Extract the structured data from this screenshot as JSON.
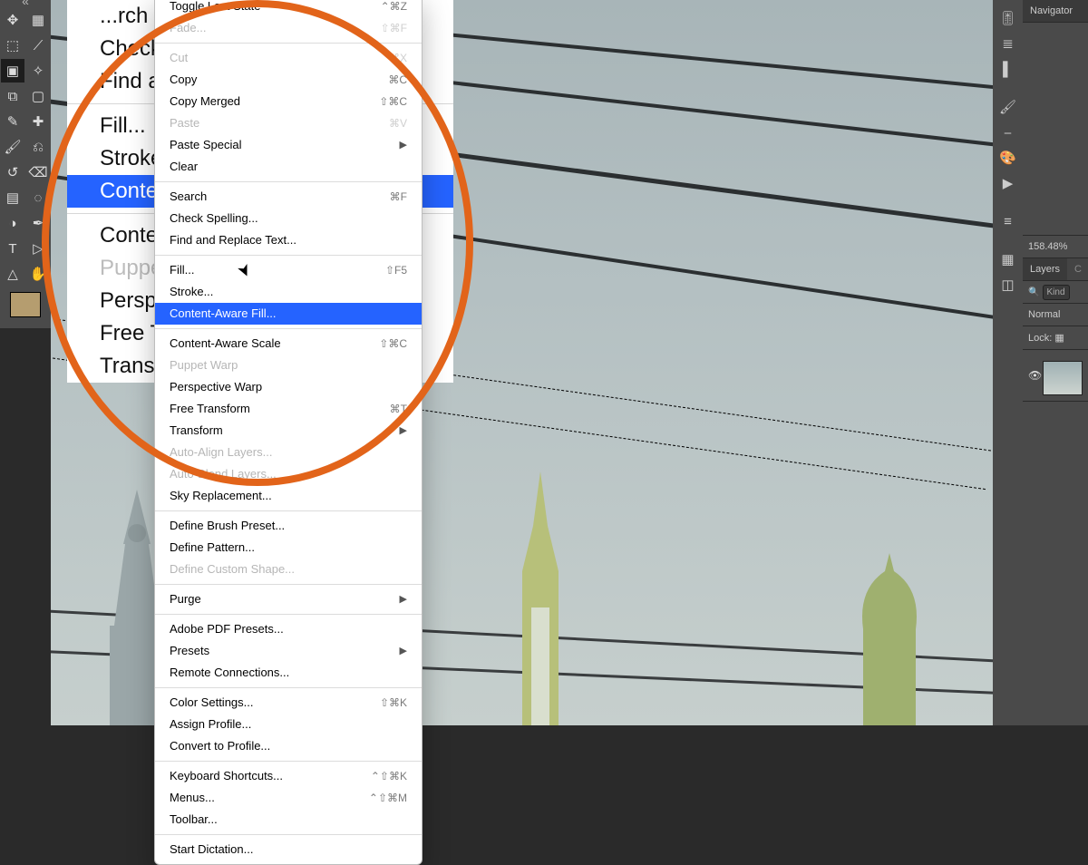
{
  "accent": "#2563ff",
  "highlight_ring": "#e2641a",
  "menu": {
    "top_items": [
      {
        "label": "Toggle Last State",
        "shortcut": "⌃⌘Z",
        "disabled": false
      },
      {
        "label": "Fade...",
        "shortcut": "⇧⌘F",
        "disabled": true
      }
    ],
    "g1": [
      {
        "label": "Cut",
        "shortcut": "⌘X",
        "disabled": true
      },
      {
        "label": "Copy",
        "shortcut": "⌘C",
        "disabled": false
      },
      {
        "label": "Copy Merged",
        "shortcut": "⇧⌘C",
        "disabled": false
      },
      {
        "label": "Paste",
        "shortcut": "⌘V",
        "disabled": true
      },
      {
        "label": "Paste Special",
        "submenu": true,
        "disabled": false
      },
      {
        "label": "Clear",
        "disabled": false
      }
    ],
    "g2": [
      {
        "label": "Search",
        "shortcut": "⌘F"
      },
      {
        "label": "Check Spelling..."
      },
      {
        "label": "Find and Replace Text..."
      }
    ],
    "g3": [
      {
        "label": "Fill...",
        "shortcut": "⇧F5"
      },
      {
        "label": "Stroke..."
      },
      {
        "label": "Content-Aware Fill...",
        "highlight": true
      }
    ],
    "g4": [
      {
        "label": "Content-Aware Scale",
        "shortcut": "⇧⌘C"
      },
      {
        "label": "Puppet Warp",
        "disabled": true
      },
      {
        "label": "Perspective Warp"
      },
      {
        "label": "Free Transform",
        "shortcut": "⌘T"
      },
      {
        "label": "Transform",
        "submenu": true
      },
      {
        "label": "Auto-Align Layers...",
        "disabled": true
      },
      {
        "label": "Auto-Blend Layers...",
        "disabled": true
      },
      {
        "label": "Sky Replacement..."
      }
    ],
    "g5": [
      {
        "label": "Define Brush Preset..."
      },
      {
        "label": "Define Pattern..."
      },
      {
        "label": "Define Custom Shape...",
        "disabled": true
      }
    ],
    "g6": [
      {
        "label": "Purge",
        "submenu": true
      }
    ],
    "g7": [
      {
        "label": "Adobe PDF Presets..."
      },
      {
        "label": "Presets",
        "submenu": true
      },
      {
        "label": "Remote Connections..."
      }
    ],
    "g8": [
      {
        "label": "Color Settings...",
        "shortcut": "⇧⌘K"
      },
      {
        "label": "Assign Profile..."
      },
      {
        "label": "Convert to Profile..."
      }
    ],
    "g9": [
      {
        "label": "Keyboard Shortcuts...",
        "shortcut": "⌃⇧⌘K"
      },
      {
        "label": "Menus...",
        "shortcut": "⌃⇧⌘M"
      },
      {
        "label": "Toolbar..."
      }
    ],
    "g10": [
      {
        "label": "Start Dictation...",
        "shortcut": ""
      }
    ]
  },
  "big_menu": [
    {
      "kind": "item",
      "label": "...rch"
    },
    {
      "kind": "item",
      "label": "Check Spelling..."
    },
    {
      "kind": "item",
      "label": "Find and Replace Text..."
    },
    {
      "kind": "sep"
    },
    {
      "kind": "item",
      "label": "Fill..."
    },
    {
      "kind": "item",
      "label": "Stroke..."
    },
    {
      "kind": "item",
      "label": "Content-Aware Fill...",
      "highlight": true
    },
    {
      "kind": "sep"
    },
    {
      "kind": "item",
      "label": "Content-Aware Scale"
    },
    {
      "kind": "item",
      "label": "Puppet Warp",
      "disabled": true
    },
    {
      "kind": "item",
      "label": "Perspective Warp"
    },
    {
      "kind": "item",
      "label": "Free Transform"
    },
    {
      "kind": "item",
      "label": "Transform"
    }
  ],
  "right_panels": {
    "navigator_tab": "Navigator",
    "zoom": "158.48%",
    "layers_tab": "Layers",
    "channels_tab_partial": "C",
    "kind_label": "Kind",
    "blend_mode": "Normal",
    "lock_label": "Lock:"
  },
  "left_tools": [
    "move-tool",
    "artboard-tool",
    "rect-marquee-tool",
    "lasso-tool",
    "object-select-tool",
    "magic-wand-tool",
    "crop-tool",
    "frame-tool",
    "eyedropper-tool",
    "spot-heal-tool",
    "brush-tool",
    "clone-stamp-tool",
    "history-brush-tool",
    "eraser-tool",
    "gradient-tool",
    "blur-tool",
    "dodge-tool",
    "pen-tool",
    "type-tool",
    "path-select-tool",
    "rectangle-tool",
    "hand-tool"
  ],
  "tool_glyphs": [
    "✥",
    "▦",
    "⬚",
    "⟋",
    "▣",
    "✧",
    "⧉",
    "▢",
    "✎",
    "✚",
    "🖌",
    "⎌",
    "↺",
    "⌫",
    "▤",
    "◌",
    "◑",
    "✒",
    "T",
    "▷",
    "△",
    "✋"
  ],
  "right_strip": [
    "adjustments-icon",
    "styles-icon",
    "swatches-icon",
    "brushes-icon",
    "brush-settings-icon",
    "color-icon",
    "play-icon",
    "paragraph-icon",
    "layer-comps-icon",
    "grid-icon"
  ],
  "right_glyphs": [
    "🎚",
    "≣",
    "▌",
    "🖌",
    "⎯",
    "🎨",
    "▶",
    "≡",
    "▦",
    "◫",
    "▤"
  ]
}
